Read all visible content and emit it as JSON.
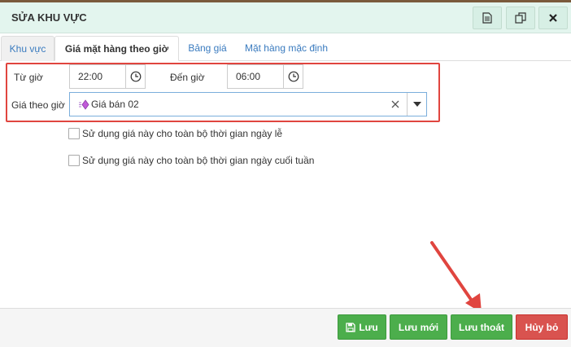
{
  "dialog": {
    "title": "SỬA KHU VỰC"
  },
  "tabs": [
    {
      "label": "Khu vực"
    },
    {
      "label": "Giá mặt hàng theo giờ",
      "active": true
    },
    {
      "label": "Bảng giá"
    },
    {
      "label": "Mặt hàng mặc định"
    }
  ],
  "form": {
    "from_label": "Từ giờ",
    "from_value": "22:00",
    "to_label": "Đến giờ",
    "to_value": "06:00",
    "price_label": "Giá theo giờ",
    "price_value": "Giá bán 02",
    "holiday_label": "Sử dụng giá này cho toàn bộ thời gian ngày lễ",
    "holiday_checked": false,
    "weekend_label": "Sử dụng giá này cho toàn bộ thời gian ngày cuối tuần",
    "weekend_checked": false
  },
  "footer": {
    "save": "Lưu",
    "save_new": "Lưu mới",
    "save_exit": "Lưu thoát",
    "cancel": "Hủy bỏ"
  },
  "colors": {
    "titlebar": "#e3f5ee",
    "green_button": "#4cae4c",
    "red_button": "#d9534f",
    "highlight": "#e0453f",
    "tab_link": "#3a7bbf"
  },
  "icons": [
    "document-icon",
    "copy-icon",
    "close-icon",
    "clock-icon",
    "tag-icon",
    "clear-icon",
    "caret-down-icon",
    "floppy-icon"
  ]
}
